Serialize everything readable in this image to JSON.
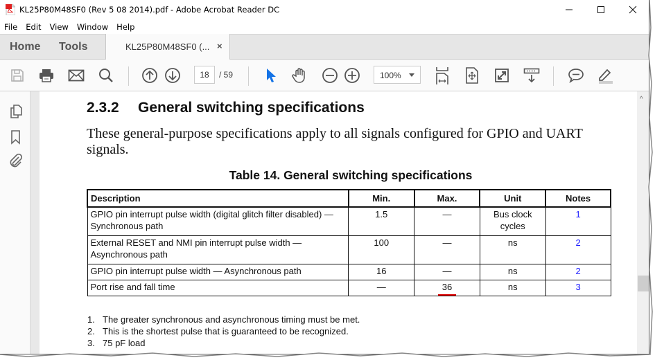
{
  "window": {
    "title": "KL25P80M48SF0 (Rev 5 08 2014).pdf - Adobe Acrobat Reader DC",
    "controls": [
      "minimize",
      "maximize",
      "close"
    ]
  },
  "menu": [
    "File",
    "Edit",
    "View",
    "Window",
    "Help"
  ],
  "tabs": {
    "home": "Home",
    "tools": "Tools",
    "document": "KL25P80M48SF0 (...",
    "close_glyph": "×"
  },
  "toolbar": {
    "page_current": "18",
    "page_total": "/ 59",
    "zoom": "100%",
    "icons": [
      "save-icon",
      "print-icon",
      "email-icon",
      "search-icon",
      "page-up-icon",
      "page-down-icon",
      "select-pointer-icon",
      "hand-icon",
      "zoom-out-icon",
      "zoom-in-icon",
      "fit-width-icon",
      "fit-page-icon",
      "full-screen-icon",
      "read-mode-icon",
      "comment-icon",
      "highlight-icon"
    ]
  },
  "sidebar": {
    "icons": [
      "page-thumbnails-icon",
      "bookmark-icon",
      "attachment-icon"
    ]
  },
  "document": {
    "section_number": "2.3.2",
    "section_title": "General switching specifications",
    "paragraph": "These general-purpose specifications apply to all signals configured for GPIO and UART signals.",
    "table_title": "Table 14.   General switching specifications",
    "table": {
      "headers": [
        "Description",
        "Min.",
        "Max.",
        "Unit",
        "Notes"
      ],
      "rows": [
        {
          "description": "GPIO pin interrupt pulse width (digital glitch filter disabled) — Synchronous path",
          "min": "1.5",
          "max": "—",
          "unit": "Bus clock cycles",
          "notes": "1"
        },
        {
          "description": "External RESET and NMI pin interrupt pulse width — Asynchronous path",
          "min": "100",
          "max": "—",
          "unit": "ns",
          "notes": "2"
        },
        {
          "description": "GPIO pin interrupt pulse width — Asynchronous path",
          "min": "16",
          "max": "—",
          "unit": "ns",
          "notes": "2"
        },
        {
          "description": "Port rise and fall time",
          "min": "—",
          "max": "36",
          "unit": "ns",
          "notes": "3"
        }
      ]
    },
    "footnotes": [
      {
        "num": "1.",
        "text": "The greater synchronous and asynchronous timing must be met."
      },
      {
        "num": "2.",
        "text": "This is the shortest pulse that is guaranteed to be recognized."
      },
      {
        "num": "3.",
        "text": "75 pF load"
      }
    ]
  },
  "colors": {
    "link": "#1a1aff",
    "highlight_underline": "#e00000",
    "select_tool": "#1473e6"
  }
}
